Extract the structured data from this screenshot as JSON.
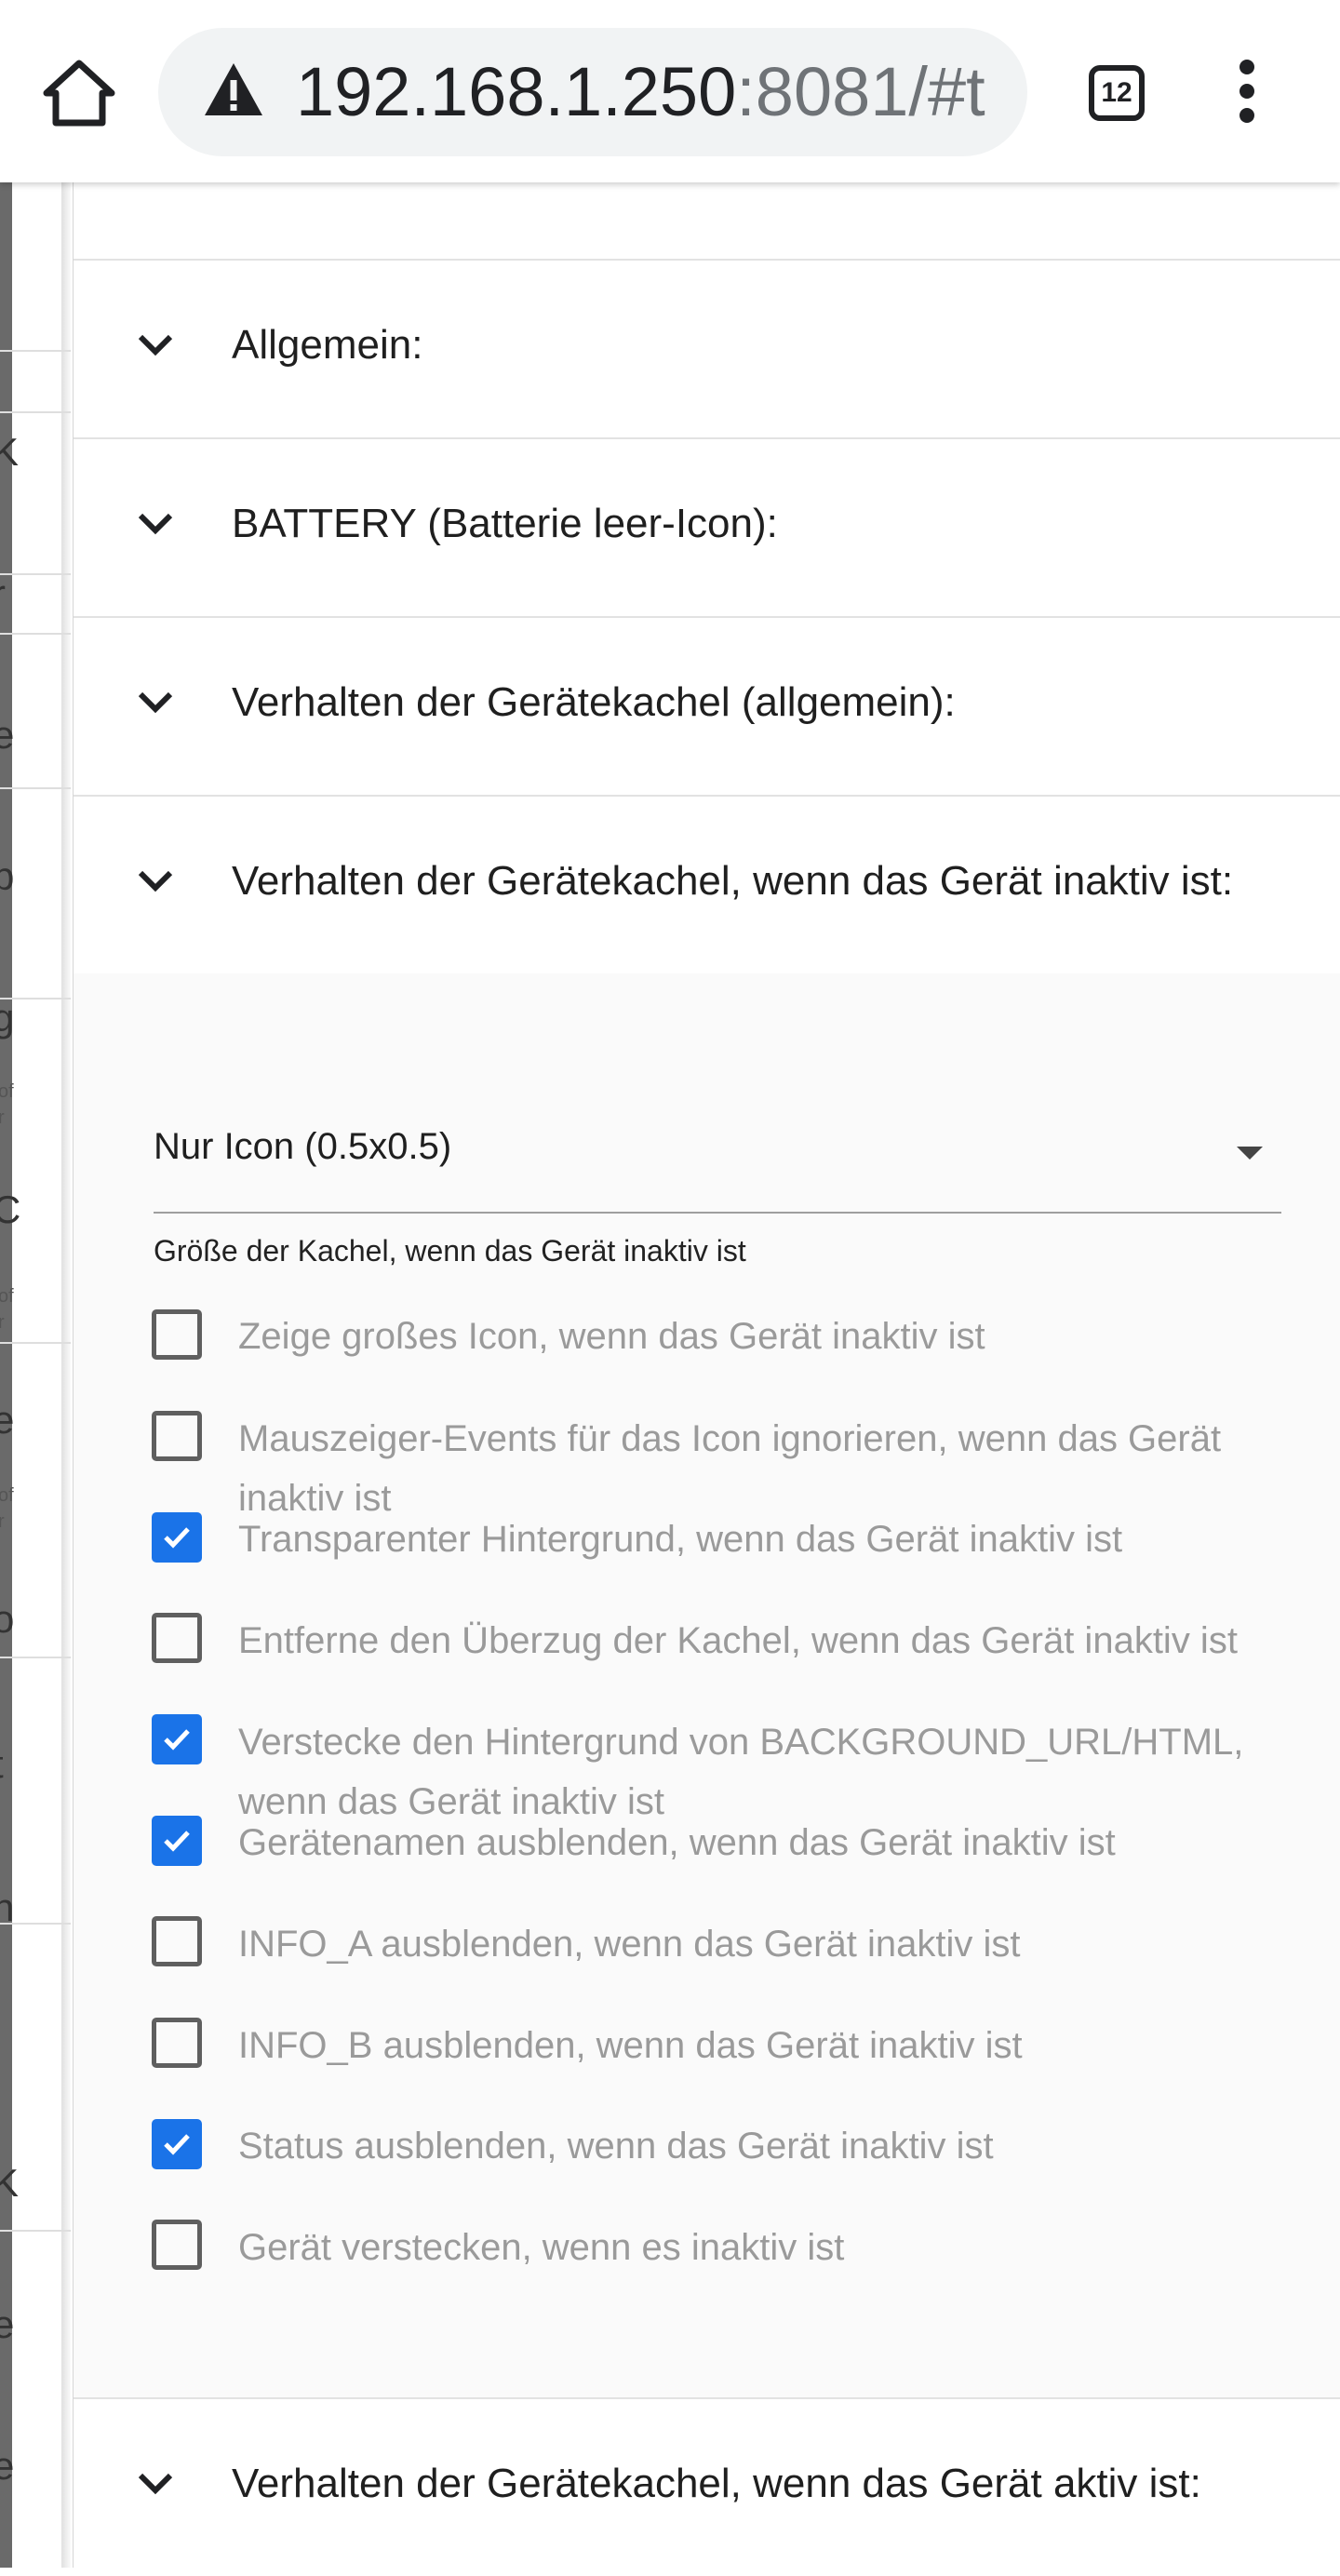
{
  "browser": {
    "url_host": "192.168.1.250",
    "url_rest": ":8081/#t",
    "tab_count": "12"
  },
  "drawer": {
    "fragments": [
      "K",
      "r",
      "e",
      "b",
      "g",
      "of",
      "r",
      "C",
      "of",
      "r",
      "e",
      "of",
      "r",
      "o",
      "t",
      "n",
      "K",
      "e",
      "e"
    ]
  },
  "sections": [
    {
      "title": "Allgemein:"
    },
    {
      "title": "BATTERY (Batterie leer-Icon):"
    },
    {
      "title": "Verhalten der Gerätekachel (allgemein):"
    },
    {
      "title": "Verhalten der Gerätekachel, wenn das Gerät inaktiv ist:"
    },
    {
      "title": "Verhalten der Gerätekachel, wenn das Gerät aktiv ist:"
    }
  ],
  "inactive_settings": {
    "tile_size": {
      "value": "Nur Icon (0.5x0.5)",
      "helper": "Größe der Kachel, wenn das Gerät inaktiv ist"
    },
    "options": [
      {
        "label": "Zeige großes Icon, wenn das Gerät inaktiv ist",
        "checked": false
      },
      {
        "label": "Mauszeiger-Events für das Icon ignorieren, wenn das Gerät inaktiv ist",
        "checked": false
      },
      {
        "label": "Transparenter Hintergrund, wenn das Gerät inaktiv ist",
        "checked": true
      },
      {
        "label": "Entferne den Überzug der Kachel, wenn das Gerät inaktiv ist",
        "checked": false
      },
      {
        "label": "Verstecke den Hintergrund von BACKGROUND_URL/HTML, wenn das Gerät inaktiv ist",
        "checked": true
      },
      {
        "label": "Gerätenamen ausblenden, wenn das Gerät inaktiv ist",
        "checked": true
      },
      {
        "label": "INFO_A ausblenden, wenn das Gerät inaktiv ist",
        "checked": false
      },
      {
        "label": "INFO_B ausblenden, wenn das Gerät inaktiv ist",
        "checked": false
      },
      {
        "label": "Status ausblenden, wenn das Gerät inaktiv ist",
        "checked": true
      },
      {
        "label": "Gerät verstecken, wenn es inaktiv ist",
        "checked": false
      }
    ]
  },
  "colors": {
    "accent": "#1a73e8",
    "label_disabled": "#9a9a9a",
    "omnibox_bg": "#f1f3f4"
  }
}
